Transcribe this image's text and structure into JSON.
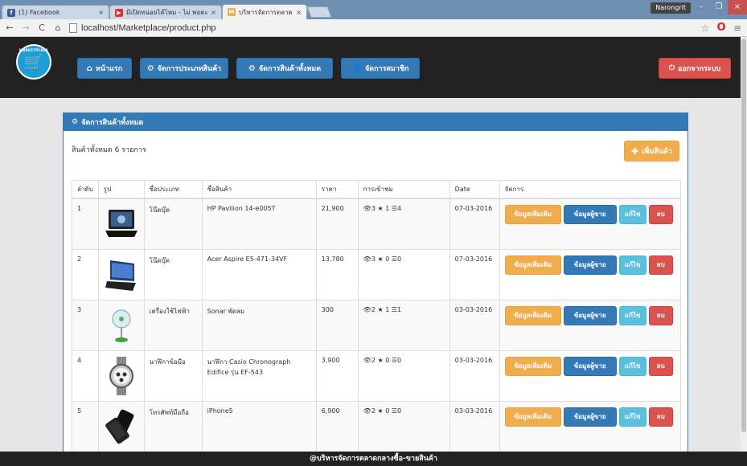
{
  "browser": {
    "tabs": [
      {
        "label": "(1) Facebook",
        "icon": "facebook-icon",
        "color": "#3b5998",
        "glyph": "f"
      },
      {
        "label": "มีเปิดหน่อยได้ไหม - ไม่ พอตะ",
        "icon": "youtube-icon",
        "color": "#e52d27",
        "glyph": "▶"
      },
      {
        "label": "บริหารจัดการตลาดกลางซื้อ-ข",
        "icon": "marketplace-icon",
        "color": "#f0ad4e",
        "glyph": "M"
      }
    ],
    "close_glyph": "×",
    "username": "Narongrit",
    "url_host": "localhost",
    "url_path": "/Marketplace/product.php"
  },
  "navbar": {
    "brand": "MARKETPLACE",
    "items": [
      {
        "label": "หน้าแรก",
        "icon": "home-icon",
        "glyph": "🏠"
      },
      {
        "label": "จัดการประเภทสินค้า",
        "icon": "gear-icon",
        "glyph": "⚙"
      },
      {
        "label": "จัดการสินค้าทั้งหมด",
        "icon": "gear-icon",
        "glyph": "⚙"
      },
      {
        "label": "จัดการสมาชิก",
        "icon": "user-icon",
        "glyph": "👤"
      }
    ],
    "logout": {
      "label": "ออกจากระบบ",
      "icon": "power-icon",
      "glyph": "⏻"
    }
  },
  "panel": {
    "title": "จัดการสินค้าทั้งหมด",
    "summary": "สินค้าทั้งหมด 6 รายการ",
    "add_button": "เพิ่มสินค้า"
  },
  "table": {
    "headers": [
      "ลำดับ",
      "รูป",
      "ชื่อประเภท",
      "ชื่อสินค้า",
      "ราคา",
      "การเข้าชม",
      "Date",
      "จัดการ"
    ],
    "rows": [
      {
        "no": "1",
        "category": "โน๊ตบุ๊ค",
        "name": "HP Pavilion 14-e005T",
        "price": "21,900",
        "views": "3",
        "stars": "1",
        "items": "4",
        "date": "07-03-2016",
        "image": "laptop-hp"
      },
      {
        "no": "2",
        "category": "โน๊ตบุ๊ค",
        "name": "Acer Aspire E5-471-34VF",
        "price": "13,780",
        "views": "3",
        "stars": "0",
        "items": "0",
        "date": "07-03-2016",
        "image": "laptop-acer"
      },
      {
        "no": "3",
        "category": "เครื่องใช้ไฟฟ้า",
        "name": "Sonar พัดลม",
        "price": "300",
        "views": "2",
        "stars": "1",
        "items": "1",
        "date": "03-03-2016",
        "image": "fan"
      },
      {
        "no": "4",
        "category": "นาฬิกาข้อมือ",
        "name": "นาฬิกา Casio Chronograph Edifice รุ่น EF-543",
        "price": "3,900",
        "views": "2",
        "stars": "0",
        "items": "0",
        "date": "03-03-2016",
        "image": "watch"
      },
      {
        "no": "5",
        "category": "โทรศัพท์มือถือ",
        "name": "iPhone5",
        "price": "6,900",
        "views": "2",
        "stars": "0",
        "items": "0",
        "date": "03-03-2016",
        "image": "phone"
      }
    ],
    "actions": {
      "info": "ข้อมูลเพิ่มเติม",
      "seller": "ข้อมูลผู้ขาย",
      "edit": "แก้ไข",
      "delete": "ลบ"
    }
  },
  "footer": "@บริหารจัดการตลาดกลางซื้อ-ขายสินค้า"
}
